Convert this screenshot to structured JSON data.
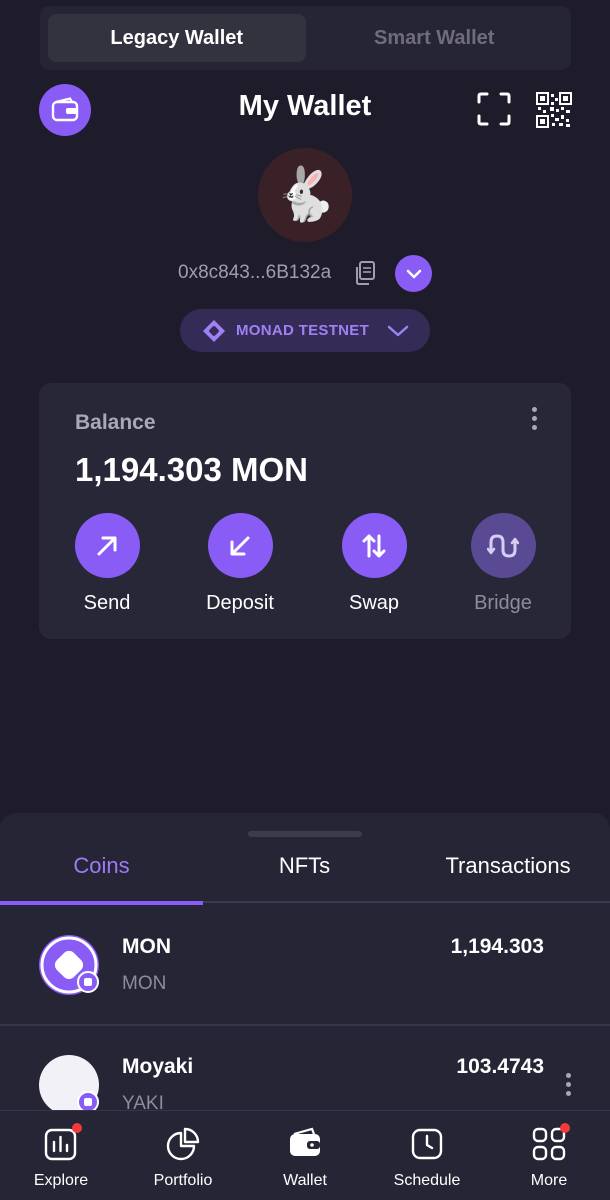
{
  "segments": {
    "legacy": "Legacy Wallet",
    "smart": "Smart Wallet"
  },
  "header": {
    "title": "My Wallet"
  },
  "profile": {
    "avatar_glyph": "🐇",
    "address": "0x8c843...6B132a"
  },
  "network": {
    "label": "MONAD TESTNET"
  },
  "balance": {
    "label": "Balance",
    "value": "1,194.303 MON",
    "actions": {
      "send": "Send",
      "deposit": "Deposit",
      "swap": "Swap",
      "bridge": "Bridge"
    }
  },
  "tabs": {
    "coins": "Coins",
    "nfts": "NFTs",
    "transactions": "Transactions"
  },
  "coins": [
    {
      "name": "MON",
      "symbol": "MON",
      "amount": "1,194.303"
    },
    {
      "name": "Moyaki",
      "symbol": "YAKI",
      "amount": "103.4743"
    }
  ],
  "nav": {
    "explore": "Explore",
    "portfolio": "Portfolio",
    "wallet": "Wallet",
    "schedule": "Schedule",
    "more": "More"
  },
  "colors": {
    "background": "#1e1c2b",
    "accent": "#8a5cf6",
    "card": "#272738",
    "badge": "#ef3b3b"
  }
}
